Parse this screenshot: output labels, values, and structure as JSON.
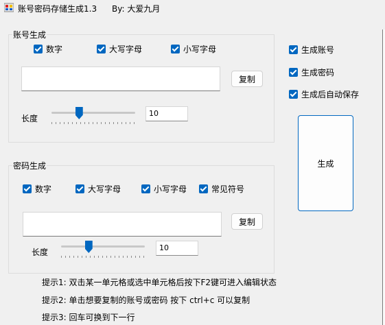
{
  "window": {
    "title": "账号密码存储生成1.3",
    "author": "By:  大爱九月"
  },
  "account_group": {
    "label": "账号生成",
    "checkboxes": [
      {
        "label": "数字",
        "checked": true
      },
      {
        "label": "大写字母",
        "checked": true
      },
      {
        "label": "小写字母",
        "checked": true
      }
    ],
    "output_value": "",
    "copy_label": "复制",
    "length_label": "长度",
    "length_value": "10",
    "slider_level": 0.33
  },
  "password_group": {
    "label": "密码生成",
    "checkboxes": [
      {
        "label": "数字",
        "checked": true
      },
      {
        "label": "大写字母",
        "checked": true
      },
      {
        "label": "小写字母",
        "checked": true
      },
      {
        "label": "常见符号",
        "checked": true
      }
    ],
    "output_value": "",
    "copy_label": "复制",
    "length_label": "长度",
    "length_value": "10",
    "slider_level": 0.33
  },
  "options": [
    {
      "label": "生成账号",
      "checked": true
    },
    {
      "label": "生成密码",
      "checked": true
    },
    {
      "label": "生成后自动保存",
      "checked": true
    }
  ],
  "generate_label": "生成",
  "hints": [
    "提示1: 双击某一单元格或选中单元格后按下F2键可进入编辑状态",
    "提示2: 单击想要复制的账号或密码 按下 ctrl+c 可以复制",
    "提示3: 回车可换到下一行"
  ],
  "colors": {
    "accent": "#0067c0",
    "background": "#f0f0f0"
  }
}
